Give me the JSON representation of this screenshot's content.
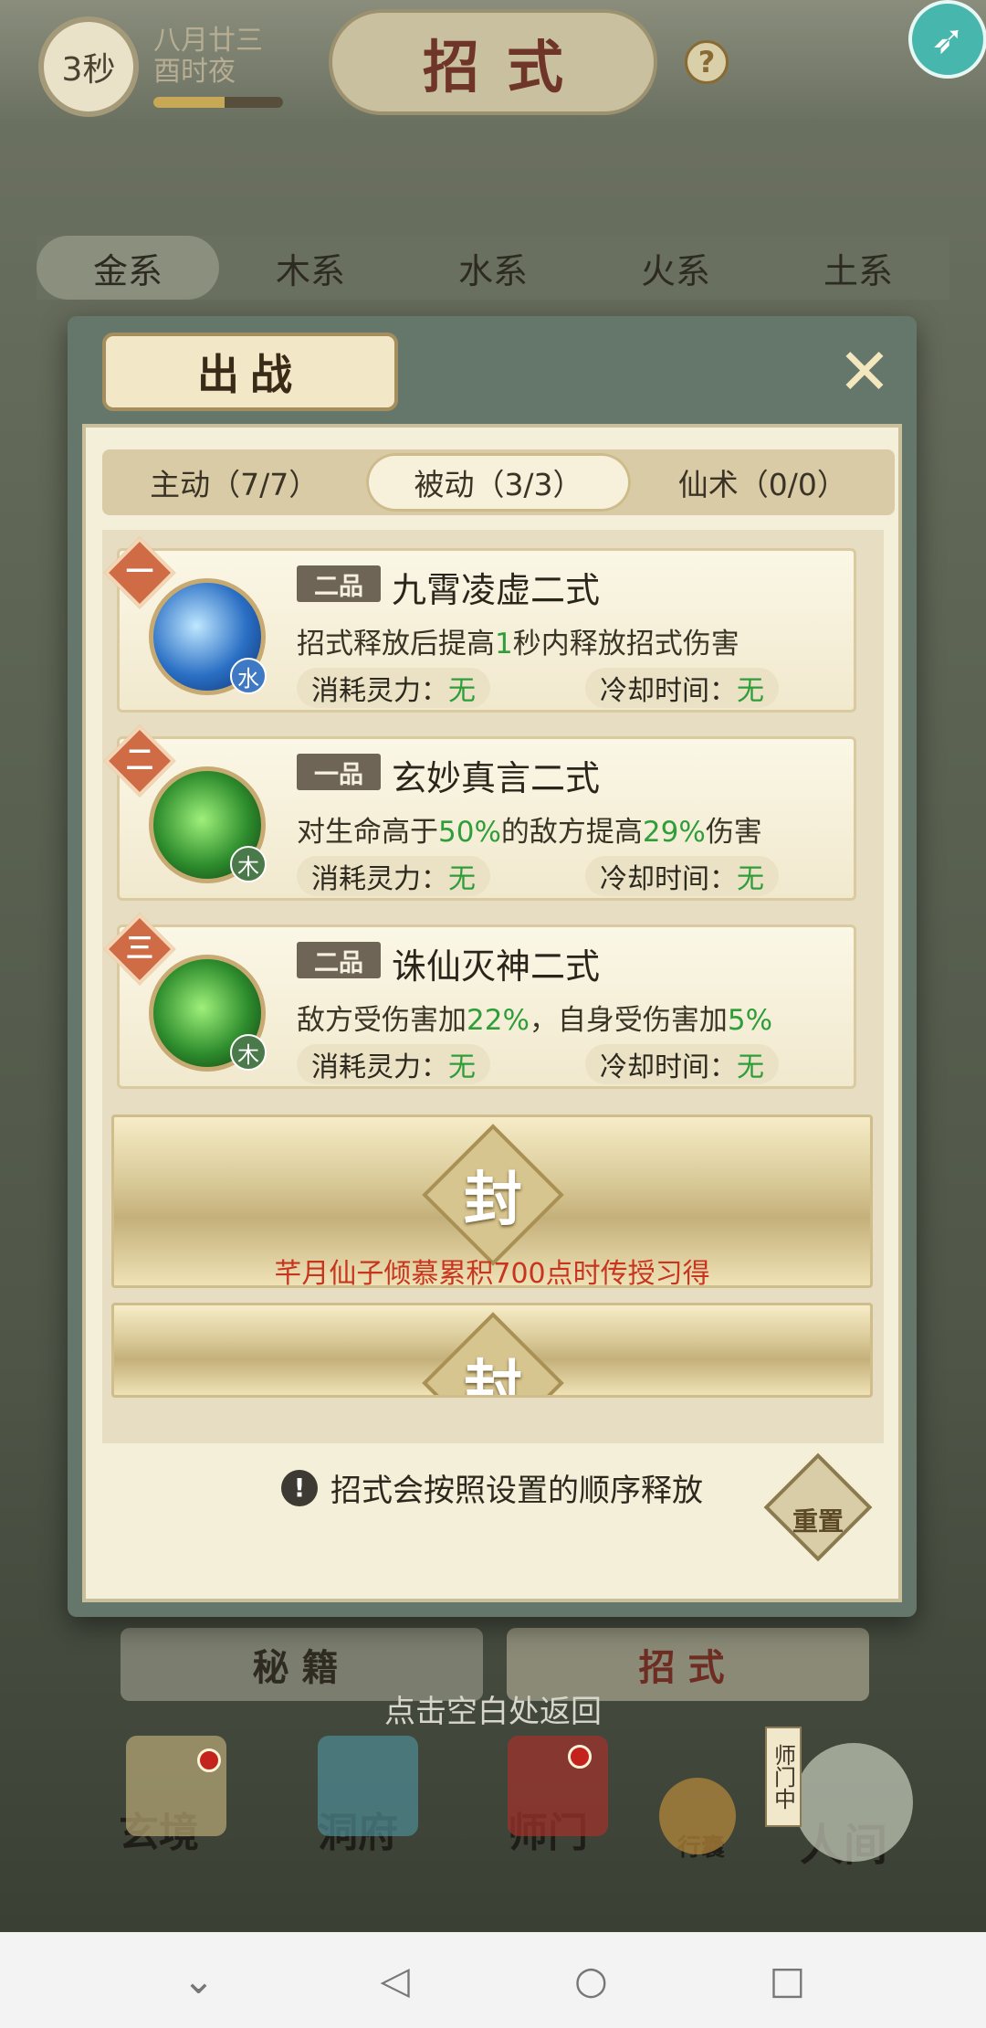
{
  "top": {
    "timer": "3秒",
    "date_line1": "八月廿三",
    "date_line2": "酉时夜",
    "title": "招式",
    "help": "?",
    "rocket_icon": "rocket-icon"
  },
  "element_tabs": [
    "金系",
    "木系",
    "水系",
    "火系",
    "土系"
  ],
  "modal": {
    "title": "出战",
    "close_icon": "close-icon",
    "modes": [
      "主动（7/7）",
      "被动（3/3）",
      "仙术（0/0）"
    ],
    "active_mode": 1,
    "skills": [
      {
        "rank": "一",
        "grade": "二品",
        "name": "九霄凌虚二式",
        "element": "水",
        "desc_parts": [
          "招式释放后提高",
          "1",
          "秒内释放招式伤害",
          "",
          ""
        ],
        "cost_label": "消耗灵力：",
        "cost": "无",
        "cd_label": "冷却时间：",
        "cd": "无"
      },
      {
        "rank": "二",
        "grade": "一品",
        "name": "玄妙真言二式",
        "element": "木",
        "desc_parts": [
          "对生命高于",
          "50%",
          "的敌方提高",
          "29%",
          "伤害"
        ],
        "cost_label": "消耗灵力：",
        "cost": "无",
        "cd_label": "冷却时间：",
        "cd": "无"
      },
      {
        "rank": "三",
        "grade": "二品",
        "name": "诛仙灭神二式",
        "element": "木",
        "desc_parts": [
          "敌方受伤害加",
          "22%",
          "，自身受伤害加",
          "5%",
          ""
        ],
        "cost_label": "消耗灵力：",
        "cost": "无",
        "cd_label": "冷却时间：",
        "cd": "无"
      }
    ],
    "sealed": [
      {
        "mark": "封",
        "note": "芊月仙子倾慕累积700点时传授习得"
      },
      {
        "mark": "封",
        "note": ""
      }
    ],
    "notice": "招式会按照设置的顺序释放",
    "reset": "重置"
  },
  "subtabs": [
    "秘籍",
    "招式"
  ],
  "back_hint": "点击空白处返回",
  "nav": {
    "items": [
      "玄境",
      "洞府",
      "师门",
      "行囊",
      "人间"
    ],
    "status": "师门中"
  },
  "system_nav": [
    "back-chevron-icon",
    "back-triangle-icon",
    "home-circle-icon",
    "recents-square-icon"
  ]
}
